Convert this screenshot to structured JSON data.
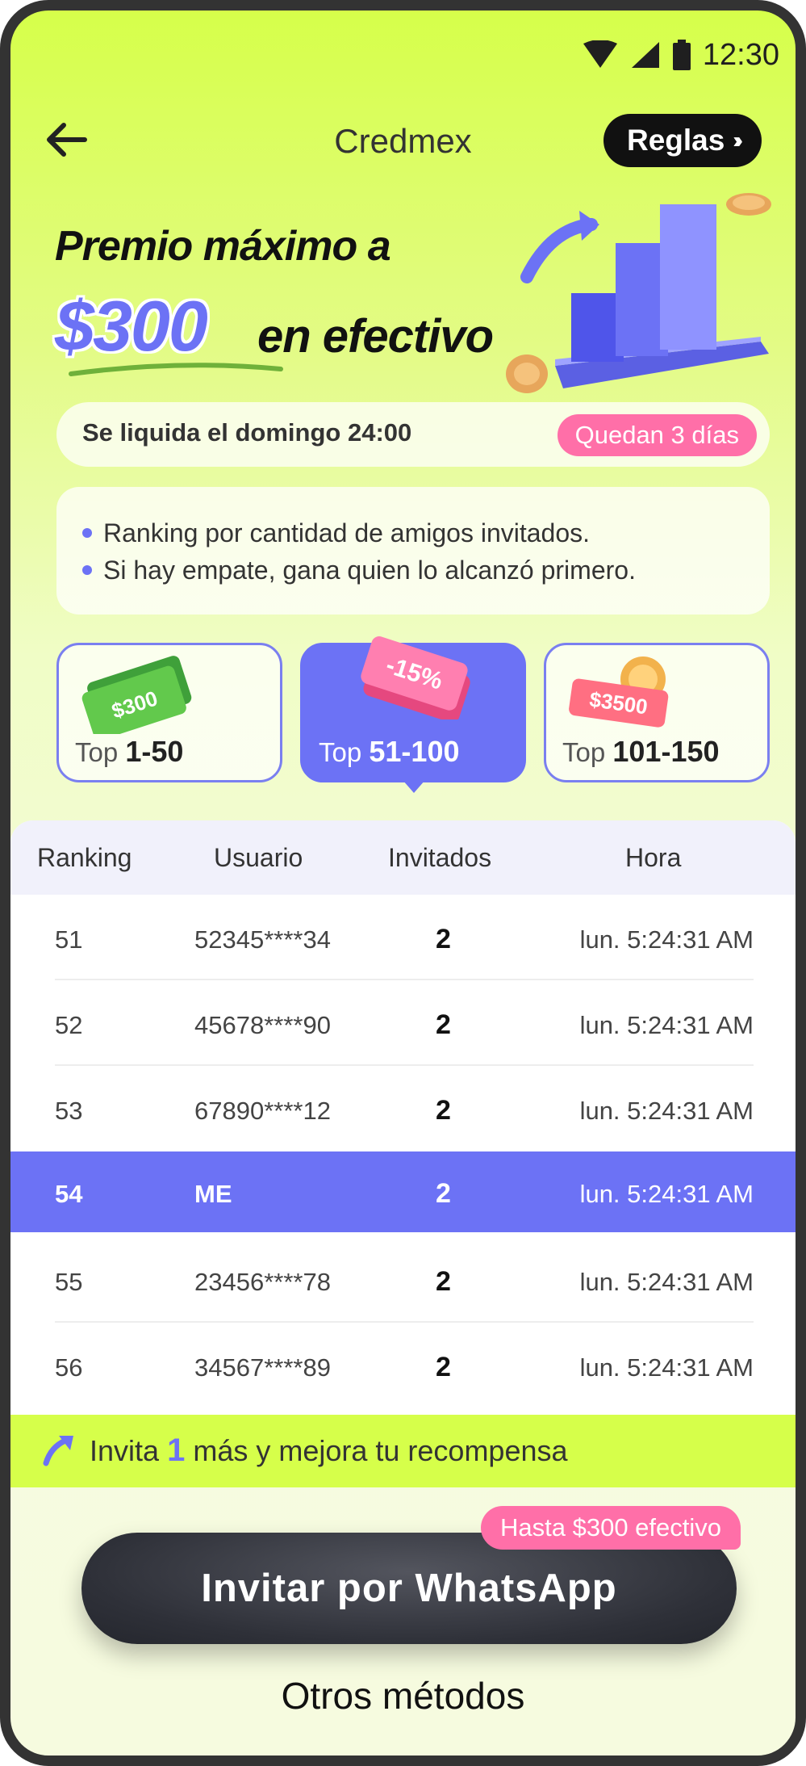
{
  "status_bar": {
    "time": "12:30"
  },
  "header": {
    "title": "Credmex",
    "rules_label": "Reglas"
  },
  "hero": {
    "line1": "Premio máximo a",
    "amount": "$300",
    "line2": "en efectivo"
  },
  "settlement": {
    "text": "Se liquida el domingo 24:00",
    "badge": "Quedan 3 días"
  },
  "rules": [
    "Ranking por cantidad de amigos invitados.",
    "Si hay empate, gana quien lo alcanzó primero."
  ],
  "tiers": [
    {
      "prefix": "Top",
      "range": "1-50",
      "prize": "$300"
    },
    {
      "prefix": "Top",
      "range": "51-100",
      "prize": "-15%"
    },
    {
      "prefix": "Top",
      "range": "101-150",
      "prize": "$3500"
    }
  ],
  "table": {
    "headers": [
      "Ranking",
      "Usuario",
      "Invitados",
      "Hora"
    ],
    "rows": [
      {
        "rank": "51",
        "user": "52345****34",
        "invited": "2",
        "time": "lun. 5:24:31 AM"
      },
      {
        "rank": "52",
        "user": "45678****90",
        "invited": "2",
        "time": "lun. 5:24:31 AM"
      },
      {
        "rank": "53",
        "user": "67890****12",
        "invited": "2",
        "time": "lun. 5:24:31 AM"
      },
      {
        "rank": "54",
        "user": "ME",
        "invited": "2",
        "time": "lun. 5:24:31 AM"
      },
      {
        "rank": "55",
        "user": "23456****78",
        "invited": "2",
        "time": "lun. 5:24:31 AM"
      },
      {
        "rank": "56",
        "user": "34567****89",
        "invited": "2",
        "time": "lun. 5:24:31 AM"
      }
    ]
  },
  "invite_banner": {
    "before": "Invita",
    "count": "1",
    "after": "más y mejora tu recompensa"
  },
  "cta": {
    "badge": "Hasta $300 efectivo",
    "label": "Invitar por WhatsApp"
  },
  "other_methods": "Otros métodos",
  "colors": {
    "accent": "#6c72f5",
    "lime": "#d6ff4a",
    "pink": "#ff6fa8",
    "dark": "#2e3038"
  }
}
